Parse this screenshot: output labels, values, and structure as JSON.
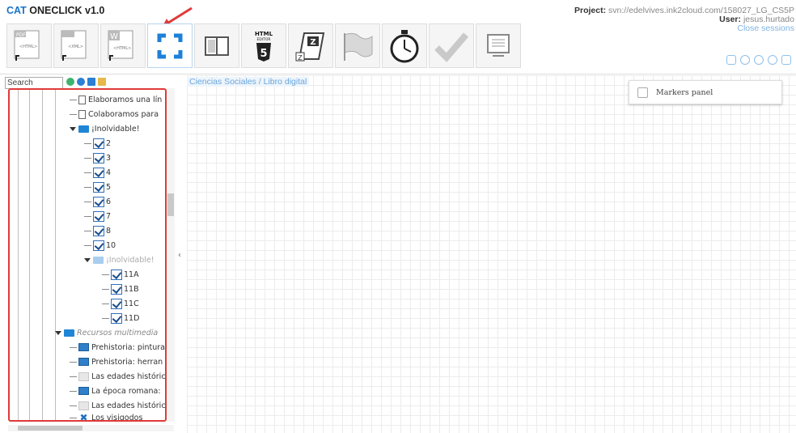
{
  "app": {
    "title_cat": "CAT",
    "title_rest": "ONECLICK v1.0"
  },
  "project": {
    "project_label": "Project:",
    "project_value": " svn://edelvives.ink2cloud.com/158027_LG_CS5P",
    "user_label": "User:",
    "user_value": " jesus.hurtado",
    "close_session": "Close sessions"
  },
  "toolbar": {
    "buttons": [
      {
        "name": "pdf-to-html",
        "tag": "PDF",
        "sub": "<HTML>"
      },
      {
        "name": "html-to-xml",
        "tag": "HTML",
        "sub": "<XML>"
      },
      {
        "name": "word-to-html",
        "tag": "W",
        "sub": "<HTML>"
      },
      {
        "name": "fullscreen",
        "tag": "",
        "sub": ""
      },
      {
        "name": "book",
        "tag": "",
        "sub": ""
      },
      {
        "name": "html-editor",
        "tag": "HTML EDITOR",
        "sub": "5"
      },
      {
        "name": "zip-export",
        "tag": "Z",
        "sub": ""
      },
      {
        "name": "flag",
        "tag": "",
        "sub": ""
      },
      {
        "name": "timer",
        "tag": "",
        "sub": ""
      },
      {
        "name": "check",
        "tag": "",
        "sub": ""
      },
      {
        "name": "preview",
        "tag": "",
        "sub": ""
      }
    ]
  },
  "sidebar": {
    "search_placeholder": "Search"
  },
  "tree": {
    "items": [
      {
        "label": "Elaboramos una lín",
        "icon": "doc"
      },
      {
        "label": "Colaboramos para",
        "icon": "doc"
      },
      {
        "label": "¡Inolvidable!",
        "icon": "folder"
      },
      {
        "label": "2",
        "icon": "check"
      },
      {
        "label": "3",
        "icon": "check"
      },
      {
        "label": "4",
        "icon": "check"
      },
      {
        "label": "5",
        "icon": "check"
      },
      {
        "label": "6",
        "icon": "check"
      },
      {
        "label": "7",
        "icon": "check"
      },
      {
        "label": "8",
        "icon": "check"
      },
      {
        "label": "10",
        "icon": "check"
      },
      {
        "label": "¡Inolvidable!",
        "icon": "folder-light"
      },
      {
        "label": "11A",
        "icon": "check"
      },
      {
        "label": "11B",
        "icon": "check"
      },
      {
        "label": "11C",
        "icon": "check"
      },
      {
        "label": "11D",
        "icon": "check"
      },
      {
        "label": "Recursos multimedia",
        "icon": "folder"
      },
      {
        "label": "Prehistoria: pintura",
        "icon": "image"
      },
      {
        "label": "Prehistoria: herran",
        "icon": "image"
      },
      {
        "label": "Las edades históric",
        "icon": "page"
      },
      {
        "label": "La época romana:",
        "icon": "image"
      },
      {
        "label": "Las edades históric",
        "icon": "page"
      },
      {
        "label": "Los visigodos",
        "icon": "x"
      }
    ]
  },
  "main": {
    "breadcrumb": "Ciencias Sociales / Libro digital",
    "markers_panel": "Markers panel"
  },
  "colors": {
    "accent": "#1a73c8",
    "highlight_border": "#e03a3a"
  }
}
